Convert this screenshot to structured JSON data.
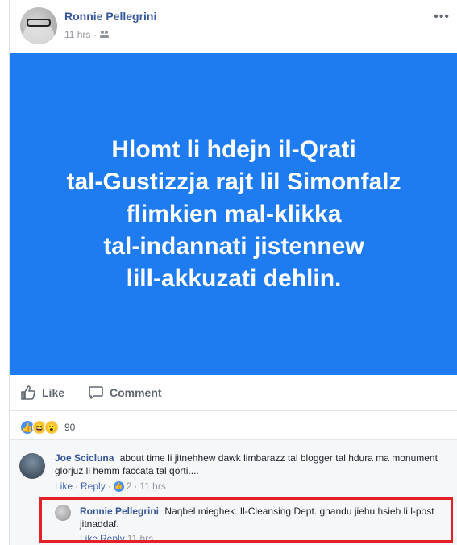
{
  "post": {
    "author": "Ronnie Pellegrini",
    "time": "11 hrs",
    "separator": "·",
    "more": "•••"
  },
  "banner": {
    "text": "Hlomt li hdejn il-Qrati\ntal-Gustizzja rajt lil Simonfalz\nflimkien mal-klikka\ntal-indannati jistennew\nlill-akkuzati dehlin.",
    "background": "#1e7bf0"
  },
  "actions": {
    "like_label": "Like",
    "comment_label": "Comment"
  },
  "reactions": {
    "count": "90"
  },
  "comments": [
    {
      "author": "Joe Scicluna",
      "text": "about time li jitnehhew dawk limbarazz tal blogger tal hdura ma monument glorjuz li hemm faccata tal qorti....",
      "like": "Like",
      "dot": "·",
      "reply": "Reply",
      "likes": "2",
      "time": "11 hrs"
    },
    {
      "author": "Ronnie Pellegrini",
      "text": "Naqbel mieghek. Il-Cleansing Dept. ghandu jiehu hsieb li l-post jitnaddaf.",
      "like": "Like",
      "reply": "Reply",
      "time": "11 hrs"
    }
  ],
  "colors": {
    "name_link": "#365899",
    "highlight_box": "#e3202a"
  }
}
